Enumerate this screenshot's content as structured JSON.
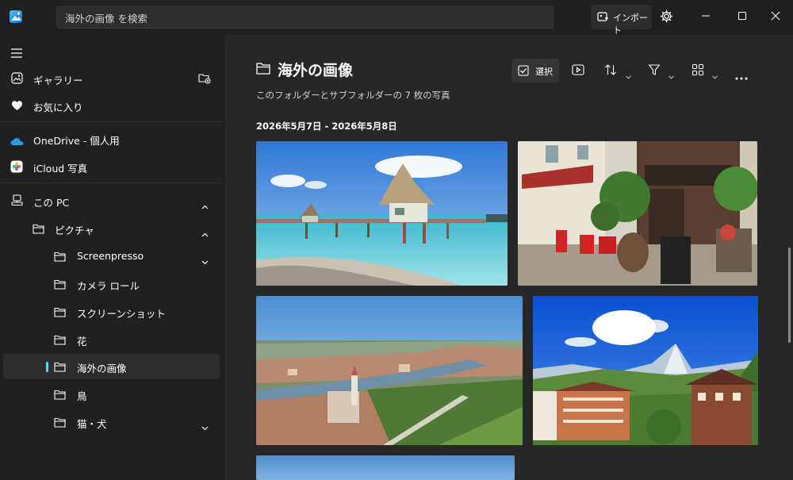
{
  "search": {
    "placeholder": "海外の画像 を検索"
  },
  "titlebar": {
    "import_label": "インポート"
  },
  "sidebar": {
    "items": [
      {
        "label": "ギャラリー"
      },
      {
        "label": "お気に入り"
      },
      {
        "label": "OneDrive - 個人用"
      },
      {
        "label": "iCloud 写真"
      },
      {
        "label": "この PC"
      },
      {
        "label": "ピクチャ"
      },
      {
        "label": "Screenpresso"
      },
      {
        "label": "カメラ ロール"
      },
      {
        "label": "スクリーンショット"
      },
      {
        "label": "花"
      },
      {
        "label": "海外の画像"
      },
      {
        "label": "鳥"
      },
      {
        "label": "猫・犬"
      }
    ]
  },
  "main": {
    "title": "海外の画像",
    "subtitle": "このフォルダーとサブフォルダーの 7 枚の写真",
    "date_range": "2026年5月7日 - 2026年5月8日",
    "select_label": "選択"
  },
  "colors": {
    "accent": "#60cdff",
    "background": "#202020",
    "content": "#272727"
  },
  "photos": [
    {
      "name": "overwater-bungalow"
    },
    {
      "name": "street-cafe"
    },
    {
      "name": "river-town"
    },
    {
      "name": "matterhorn-village"
    },
    {
      "name": "sky"
    }
  ]
}
